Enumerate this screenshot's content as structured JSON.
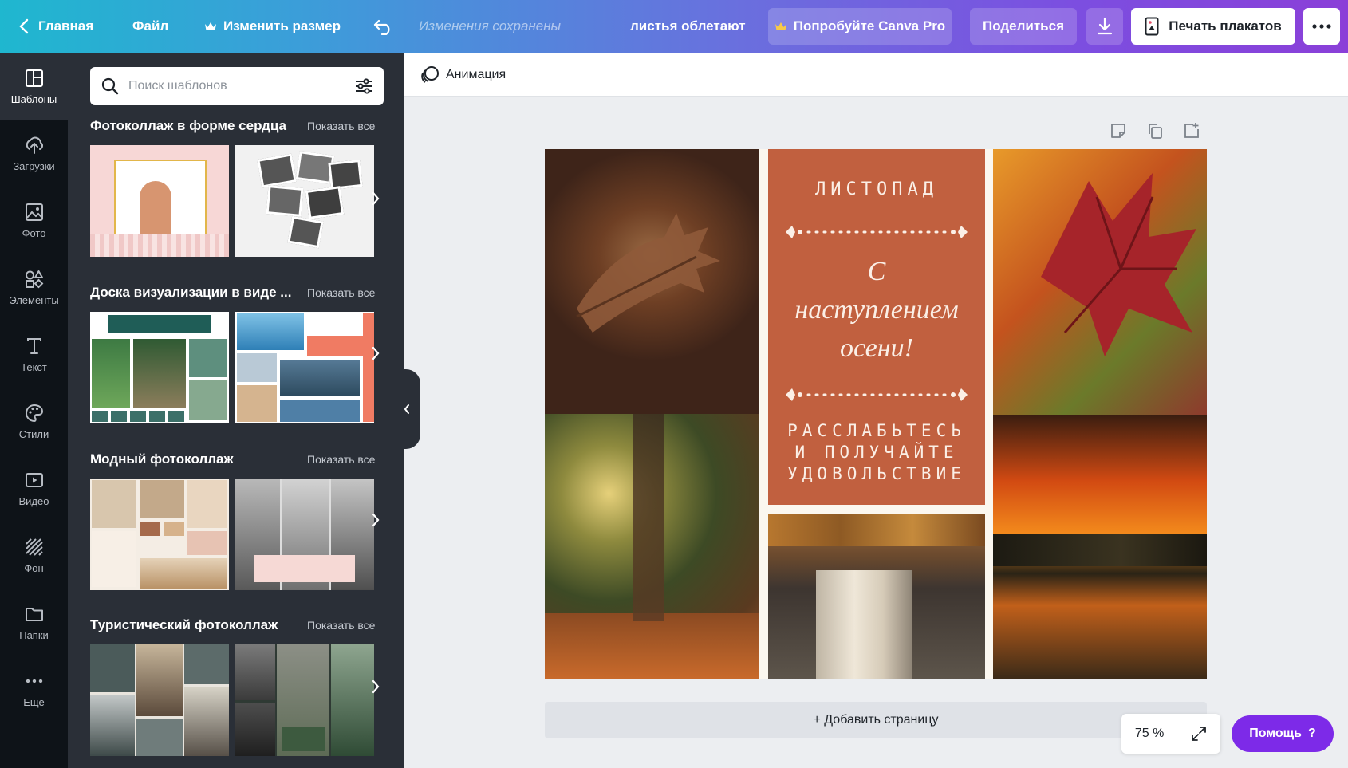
{
  "topbar": {
    "home_label": "Главная",
    "file_label": "Файл",
    "resize_label": "Изменить размер",
    "saved_status": "Изменения сохранены",
    "design_title": "листья облетают",
    "pro_label": "Попробуйте Canva Pro",
    "share_label": "Поделиться",
    "print_label": "Печать плакатов",
    "more_icon": "more-icon"
  },
  "rail": {
    "items": [
      {
        "label": "Шаблоны",
        "icon": "templates-icon",
        "active": true
      },
      {
        "label": "Загрузки",
        "icon": "upload-icon"
      },
      {
        "label": "Фото",
        "icon": "photo-icon"
      },
      {
        "label": "Элементы",
        "icon": "elements-icon"
      },
      {
        "label": "Текст",
        "icon": "text-icon"
      },
      {
        "label": "Стили",
        "icon": "styles-icon"
      },
      {
        "label": "Видео",
        "icon": "video-icon"
      },
      {
        "label": "Фон",
        "icon": "background-icon"
      },
      {
        "label": "Папки",
        "icon": "folder-icon"
      },
      {
        "label": "Еще",
        "icon": "more-dots-icon"
      }
    ]
  },
  "panel": {
    "search_placeholder": "Поиск шаблонов",
    "sections": [
      {
        "title": "Фотоколлаж в форме сердца",
        "show_all": "Показать все"
      },
      {
        "title": "Доска визуализации в виде ...",
        "show_all": "Показать все"
      },
      {
        "title": "Модный фотоколлаж",
        "show_all": "Показать все"
      },
      {
        "title": "Туристический фотоколлаж",
        "show_all": "Показать все"
      }
    ]
  },
  "editor": {
    "animation_label": "Анимация",
    "add_page_label": "+ Добавить страницу",
    "zoom_label": "75 %",
    "help_label": "Помощь",
    "help_icon_glyph": "?"
  },
  "card": {
    "title": "ЛИСТОПАД",
    "script_lines": [
      "С",
      "наступлением",
      "осени!"
    ],
    "bottom_lines": [
      "РАССЛАБЬТЕСЬ",
      "И ПОЛУЧАЙТЕ",
      "УДОВОЛЬСТВИЕ"
    ],
    "color": "#c1603f"
  }
}
